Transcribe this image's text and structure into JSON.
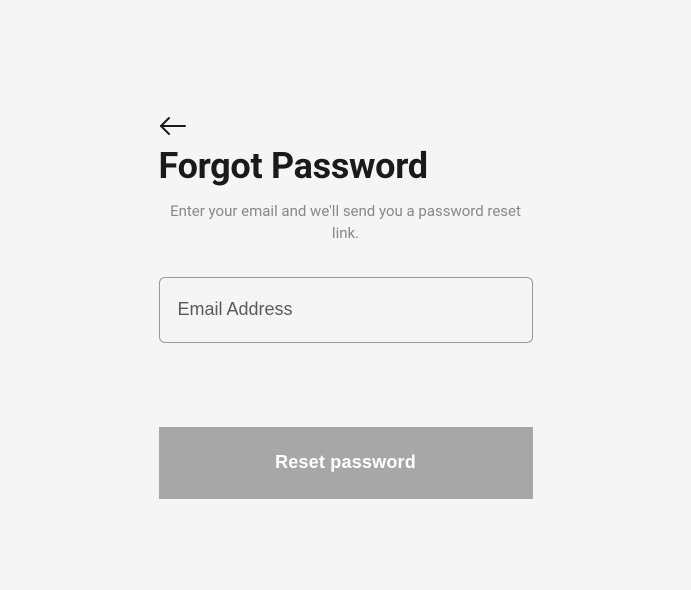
{
  "page": {
    "title": "Forgot Password",
    "subtitle": "Enter your email and we'll send you a password reset link."
  },
  "form": {
    "email": {
      "placeholder": "Email Address",
      "value": ""
    },
    "submitLabel": "Reset password"
  }
}
